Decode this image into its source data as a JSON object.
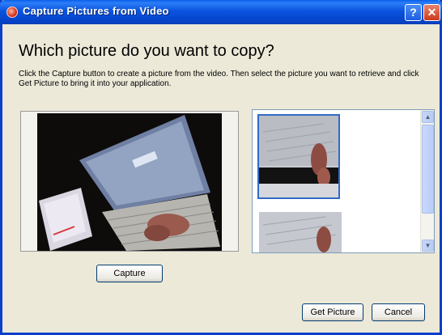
{
  "window": {
    "title": "Capture Pictures from Video",
    "help_label": "?",
    "close_label": "✕"
  },
  "heading": "Which picture do you want to copy?",
  "instructions": "Click the Capture button to create a picture from the video.  Then select the picture you want to retrieve and click Get Picture to bring it into your application.",
  "buttons": {
    "capture": "Capture",
    "get_picture": "Get Picture",
    "cancel": "Cancel"
  },
  "scroll_icons": {
    "up": "▲",
    "down": "▼"
  },
  "colors": {
    "titlebar": "#0A54E0",
    "window_bg": "#ECE9D8",
    "selection_border": "#316AC5"
  }
}
